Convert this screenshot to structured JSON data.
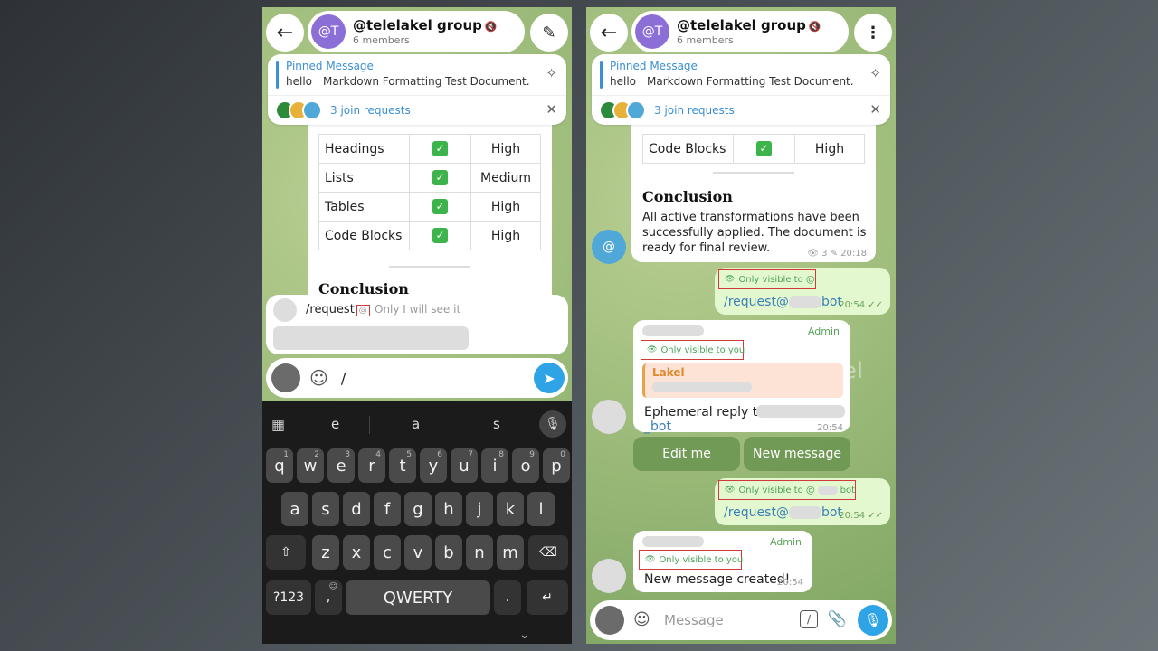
{
  "header": {
    "avatar_initials": "@T",
    "group_name": "@telelakel group",
    "mute_icon": "🔇",
    "members": "6 members"
  },
  "pinned": {
    "title": "Pinned Message",
    "text_a": "hello",
    "text_b": "Markdown Formatting Test Document..."
  },
  "join_requests": "3 join requests",
  "watermark": "@telelakel",
  "table_left": [
    {
      "feature": "Headings",
      "support": "✓",
      "level": "High"
    },
    {
      "feature": "Lists",
      "support": "✓",
      "level": "Medium"
    },
    {
      "feature": "Tables",
      "support": "✓",
      "level": "High"
    },
    {
      "feature": "Code Blocks",
      "support": "✓",
      "level": "High"
    }
  ],
  "conclusion_heading": "Conclusion",
  "suggestion": {
    "command": "/request",
    "description": "Only I will see it"
  },
  "composer_left": {
    "value": "/"
  },
  "keyboard": {
    "suggestions": [
      "e",
      "a",
      "s"
    ],
    "row1": [
      "q",
      "w",
      "e",
      "r",
      "t",
      "y",
      "u",
      "i",
      "o",
      "p"
    ],
    "row1_sup": [
      "1",
      "2",
      "3",
      "4",
      "5",
      "6",
      "7",
      "8",
      "9",
      "0"
    ],
    "row2": [
      "a",
      "s",
      "d",
      "f",
      "g",
      "h",
      "j",
      "k",
      "l"
    ],
    "row3": [
      "z",
      "x",
      "c",
      "v",
      "b",
      "n",
      "m"
    ],
    "sym_key": "?123",
    "comma_key": ",",
    "emoji_sup": "☺",
    "space_label": "QWERTY",
    "period_key": "."
  },
  "right": {
    "table_last": {
      "feature": "Code Blocks",
      "support": "✓",
      "level": "High"
    },
    "conclusion_heading": "Conclusion",
    "conclusion_body_1": "All active transformations have been",
    "conclusion_body_2": "successfully applied. The document is",
    "conclusion_body_3": "ready for final review.",
    "conclusion_meta": "👁 3  ✎ 20:18",
    "avatar_at": "@",
    "out1_badge": "Only visible to @",
    "out1_cmd_a": "/request@",
    "out1_cmd_b": "bot",
    "out1_time": "20:54 ✓✓",
    "admin_label": "Admin",
    "in1_badge": "Only visible to you",
    "reply_name": "Lakel",
    "in1_text": "Ephemeral reply to:",
    "in1_link": "_bot",
    "in1_time": "20:54",
    "btn_edit": "Edit me",
    "btn_new": "New message",
    "out2_badge_a": "Only visible to @",
    "out2_badge_b": "bot",
    "out2_cmd_a": "/request@",
    "out2_cmd_b": "bot",
    "out2_time": "20:54 ✓✓",
    "admin_label_2": "Admin",
    "in2_badge": "Only visible to you",
    "in2_text": "New message created!",
    "in2_time": "20:54",
    "composer_placeholder": "Message"
  },
  "colors": {
    "accent": "#2ea4e6",
    "outgoing_bubble": "#e4f8cf",
    "inline_button": "#689450",
    "highlight_box": "#d23a3a"
  }
}
